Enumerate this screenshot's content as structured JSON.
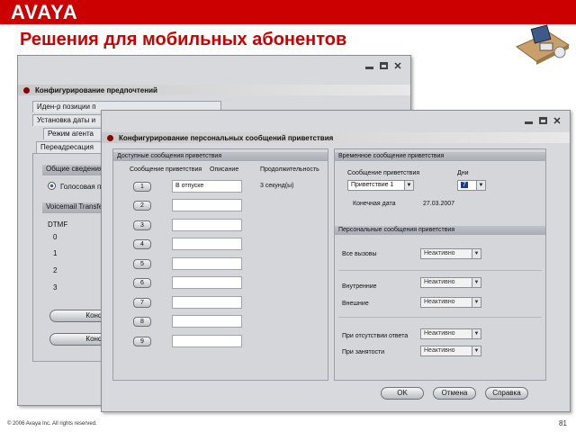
{
  "header": {
    "logo": "AVAYA",
    "title": "Решения для мобильных абонентов"
  },
  "footer": {
    "copyright": "© 2006 Avaya Inc. All rights reserved.",
    "page": "81"
  },
  "colors": {
    "brand": "#cc0000",
    "window": "#d7d9dc"
  },
  "win1": {
    "title": "Конфигурирование предпочтений",
    "tabs": [
      "Иден-р позиции п",
      "Установка даты и",
      "Режим агента",
      "Переадресация"
    ],
    "section": "Общие сведения",
    "radio_label": "Голосовая п",
    "voicemail": "Voicemail Transfe",
    "dtmf": "DTMF",
    "dtmf_values": [
      "0",
      "1",
      "2",
      "3"
    ],
    "buttons": [
      "Конфи",
      "Конфи"
    ]
  },
  "win2": {
    "title": "Конфигурирование персональных сообщений приветствия",
    "available": {
      "header": "Доступные сообщения приветствия",
      "col_greeting": "Сообщение приветствия",
      "col_desc": "Описание",
      "col_duration": "Продолжительность",
      "rows": [
        {
          "num": "1",
          "desc": "В отпуске",
          "duration": "3 секунд(ы)"
        },
        {
          "num": "2",
          "desc": "",
          "duration": ""
        },
        {
          "num": "3",
          "desc": "",
          "duration": ""
        },
        {
          "num": "4",
          "desc": "",
          "duration": ""
        },
        {
          "num": "5",
          "desc": "",
          "duration": ""
        },
        {
          "num": "6",
          "desc": "",
          "duration": ""
        },
        {
          "num": "7",
          "desc": "",
          "duration": ""
        },
        {
          "num": "8",
          "desc": "",
          "duration": ""
        },
        {
          "num": "9",
          "desc": "",
          "duration": ""
        }
      ]
    },
    "temporary": {
      "header": "Временное сообщение приветствия",
      "greeting_label": "Сообщение приветствия",
      "greeting_value": "Приветствие 1",
      "days_label": "Дни",
      "days_value": "7",
      "end_date_label": "Конечная дата",
      "end_date_value": "27.03.2007"
    },
    "personal": {
      "header": "Персональные сообщения приветствия",
      "all_calls_label": "Все вызовы",
      "all_calls_value": "Неактивно",
      "internal_label": "Внутренние",
      "internal_value": "Неактивно",
      "external_label": "Внешние",
      "external_value": "Неактивно",
      "no_answer_label": "При отсутствии ответа",
      "no_answer_value": "Неактивно",
      "busy_label": "При занятости",
      "busy_value": "Неактивно"
    },
    "buttons": {
      "ok": "OK",
      "cancel": "Отмена",
      "help": "Справка"
    }
  }
}
